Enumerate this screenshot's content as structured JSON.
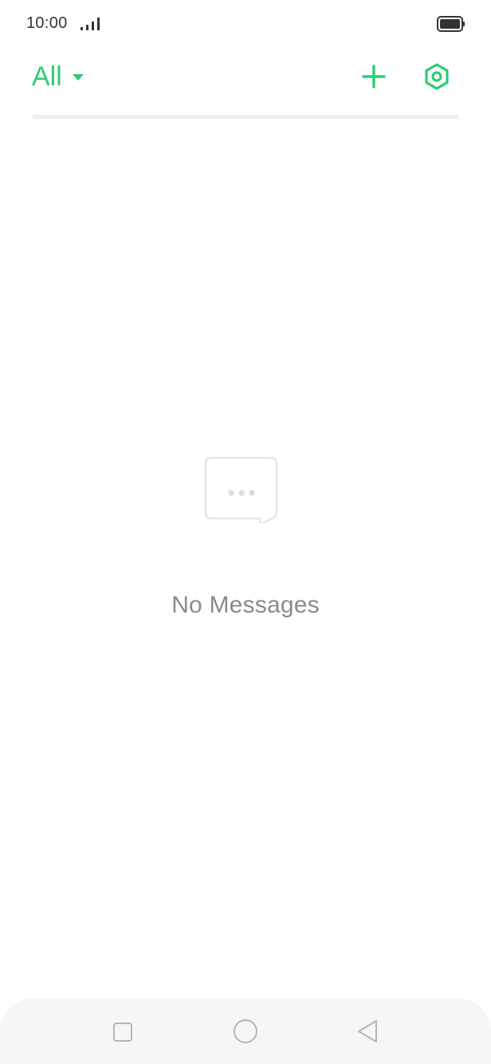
{
  "status_bar": {
    "time": "10:00",
    "signal_icon": "signal-bars-icon",
    "battery_icon": "battery-full-icon"
  },
  "header": {
    "filter_label": "All",
    "filter_icon": "caret-down-icon",
    "add_icon": "plus-icon",
    "settings_icon": "settings-hexagon-icon"
  },
  "empty_state": {
    "icon": "chat-bubble-icon",
    "message": "No Messages"
  },
  "nav_bar": {
    "recent_icon": "square-icon",
    "home_icon": "circle-icon",
    "back_icon": "triangle-back-icon"
  },
  "colors": {
    "accent": "#2ecc71",
    "divider": "#eeeeee",
    "empty_text": "#8a8a8a",
    "nav_background": "#f6f6f6"
  }
}
